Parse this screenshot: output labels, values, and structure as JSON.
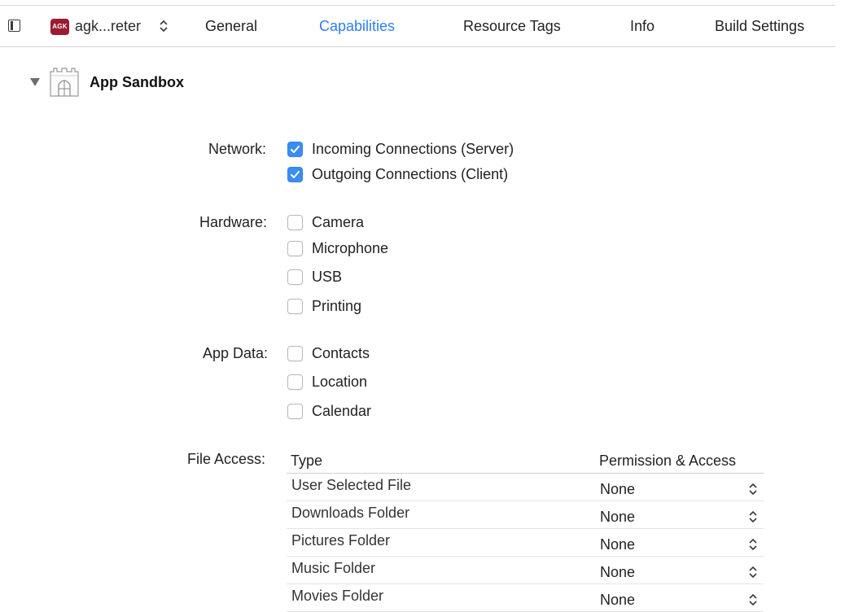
{
  "tabbar": {
    "target_badge": "AGK",
    "target_name": "agk...reter",
    "tabs": [
      {
        "label": "General"
      },
      {
        "label": "Capabilities"
      },
      {
        "label": "Resource Tags"
      },
      {
        "label": "Info"
      },
      {
        "label": "Build Settings"
      }
    ],
    "active_tab": "Capabilities",
    "accent_color": "#2f7df6"
  },
  "section": {
    "title": "App Sandbox",
    "expanded": true
  },
  "network": {
    "label": "Network:",
    "options": [
      {
        "label": "Incoming Connections (Server)",
        "checked": true
      },
      {
        "label": "Outgoing Connections (Client)",
        "checked": true
      }
    ]
  },
  "hardware": {
    "label": "Hardware:",
    "options": [
      {
        "label": "Camera",
        "checked": false
      },
      {
        "label": "Microphone",
        "checked": false
      },
      {
        "label": "USB",
        "checked": false
      },
      {
        "label": "Printing",
        "checked": false
      }
    ]
  },
  "app_data": {
    "label": "App Data:",
    "options": [
      {
        "label": "Contacts",
        "checked": false
      },
      {
        "label": "Location",
        "checked": false
      },
      {
        "label": "Calendar",
        "checked": false
      }
    ]
  },
  "file_access": {
    "label": "File Access:",
    "columns": [
      "Type",
      "Permission & Access"
    ],
    "rows": [
      {
        "type": "User Selected File",
        "permission": "None"
      },
      {
        "type": "Downloads Folder",
        "permission": "None"
      },
      {
        "type": "Pictures Folder",
        "permission": "None"
      },
      {
        "type": "Music Folder",
        "permission": "None"
      },
      {
        "type": "Movies Folder",
        "permission": "None"
      }
    ]
  }
}
